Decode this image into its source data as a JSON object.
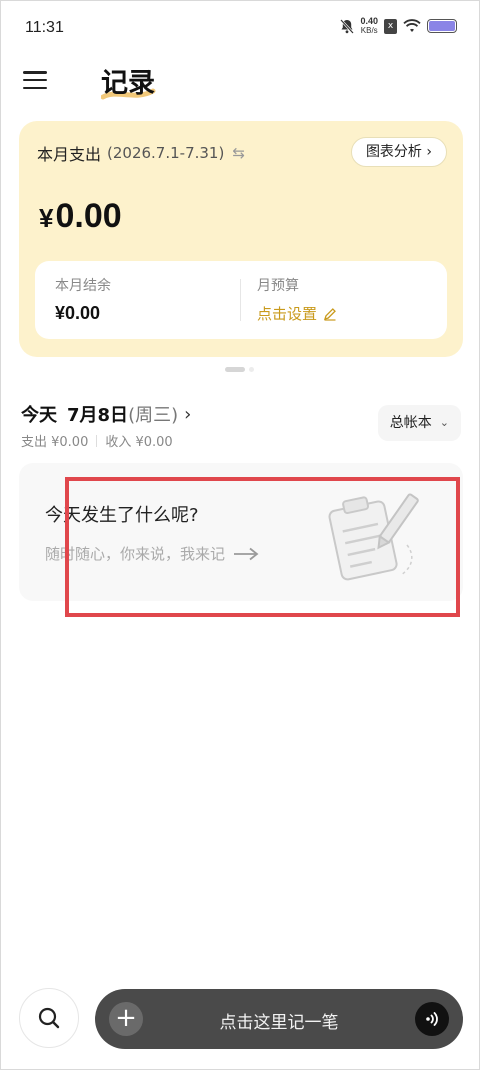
{
  "status_bar": {
    "time": "11:31",
    "net_speed_value": "0.40",
    "net_speed_unit": "KB/s",
    "sim_badge": "x",
    "battery_color": "#8a84e6"
  },
  "header": {
    "title": "记录",
    "accent_color": "#f1c87a"
  },
  "summary": {
    "label": "本月支出",
    "range": "(2026.7.1-7.31)",
    "chart_button": "图表分析 ›",
    "currency": "¥",
    "amount": "0.00",
    "balance_label": "本月结余",
    "balance_value": "¥0.00",
    "budget_label": "月预算",
    "budget_action": "点击设置",
    "card_color": "#fdf2cc",
    "action_color": "#c99a1c"
  },
  "day": {
    "today": "今天",
    "date": "7月8日",
    "weekday": "(周三)",
    "chevron": "›",
    "expense_text": "支出 ¥0.00",
    "income_text": "收入 ¥0.00",
    "ledger": "总帐本",
    "ledger_caret": "⌄"
  },
  "prompt": {
    "title": "今天发生了什么呢?",
    "subtitle": "随时随心，你来说，我来记",
    "highlight_color": "#e0474c"
  },
  "bottom": {
    "plus": "+",
    "record_label": "点击这里记一笔"
  }
}
